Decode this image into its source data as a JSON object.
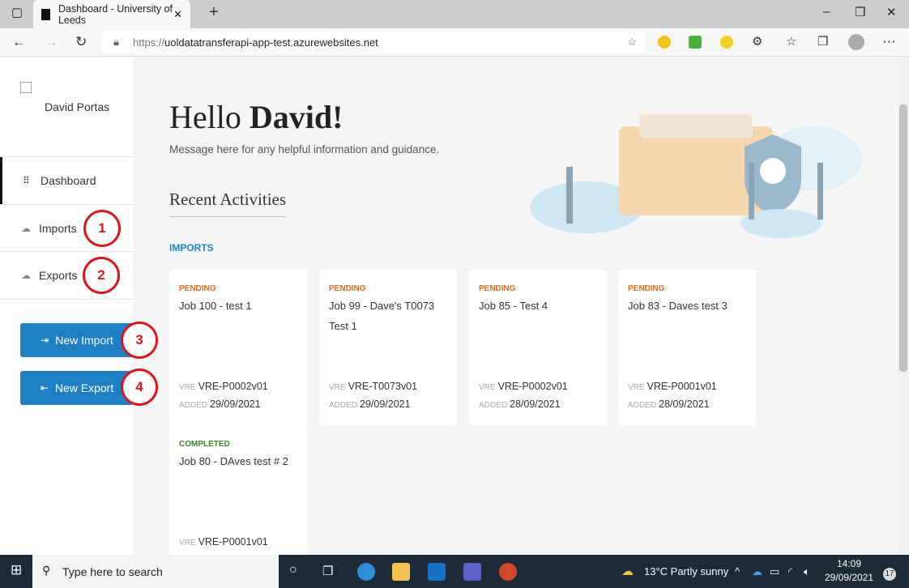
{
  "browser": {
    "tab_title": "Dashboard - University of Leeds",
    "url_proto": "https://",
    "url_host": "uoldatatransferapi-app-test.azurewebsites.net"
  },
  "sidebar": {
    "user": "David Portas",
    "items": [
      {
        "label": "Dashboard",
        "icon": "grid-icon"
      },
      {
        "label": "Imports",
        "icon": "cloud-download-icon"
      },
      {
        "label": "Exports",
        "icon": "cloud-upload-icon"
      }
    ],
    "new_import": "New Import",
    "new_export": "New Export"
  },
  "annotations": [
    "1",
    "2",
    "3",
    "4"
  ],
  "annotation_color": "#e0141e",
  "main": {
    "hello": "Hello ",
    "name": "David!",
    "message": "Message here for any helpful information and guidance.",
    "recent": "Recent Activities",
    "imports_label": "IMPORTS",
    "cards": [
      {
        "status": "PENDING",
        "title": "Job 100 - test 1",
        "vre_label": "VRE",
        "vre": "VRE-P0002v01",
        "added_label": "ADDED",
        "added": "29/09/2021"
      },
      {
        "status": "PENDING",
        "title": "Job 99 - Dave's T0073 Test 1",
        "vre_label": "VRE",
        "vre": "VRE-T0073v01",
        "added_label": "ADDED",
        "added": "29/09/2021"
      },
      {
        "status": "PENDING",
        "title": "Job 85 - Test 4",
        "vre_label": "VRE",
        "vre": "VRE-P0002v01",
        "added_label": "ADDED",
        "added": "28/09/2021"
      },
      {
        "status": "PENDING",
        "title": "Job 83 - Daves test 3",
        "vre_label": "VRE",
        "vre": "VRE-P0001v01",
        "added_label": "ADDED",
        "added": "28/09/2021"
      },
      {
        "status": "COMPLETED",
        "title": "Job 80 - DAves test # 2",
        "vre_label": "VRE",
        "vre": "VRE-P0001v01"
      }
    ]
  },
  "taskbar": {
    "search_placeholder": "Type here to search",
    "weather": "13°C  Partly sunny",
    "time": "14:09",
    "date": "29/09/2021",
    "notifications": "17"
  }
}
